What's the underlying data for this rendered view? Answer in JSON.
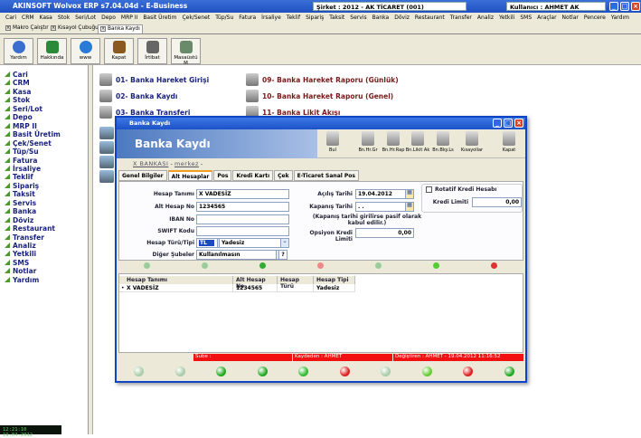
{
  "app": {
    "title": "AKINSOFT Wolvox ERP s7.04.04d - E-Business",
    "company": "Şirket : 2012 - AK TİCARET (001)",
    "user": "Kullanıcı : AHMET AK"
  },
  "menu": [
    "Cari",
    "CRM",
    "Kasa",
    "Stok",
    "Seri/Lot",
    "Depo",
    "MRP II",
    "Basit Üretim",
    "Çek/Senet",
    "Tüp/Su",
    "Fatura",
    "İrsaliye",
    "Teklif",
    "Sipariş",
    "Taksit",
    "Servis",
    "Banka",
    "Döviz",
    "Restaurant",
    "Transfer",
    "Analiz",
    "Yetkili",
    "SMS",
    "Araçlar",
    "Notlar",
    "Pencere",
    "Yardım"
  ],
  "doc_tabs": [
    "Makro Çalıştır",
    "Kısayol Çubuğu",
    "Banka Kaydı"
  ],
  "toolbar": [
    "Yardım",
    "Hakkında",
    "www",
    "Kapat",
    "İrtibat",
    "Masaüstü M"
  ],
  "sidebar": [
    "Cari",
    "CRM",
    "Kasa",
    "Stok",
    "Seri/Lot",
    "Depo",
    "MRP II",
    "Basit Üretim",
    "Çek/Senet",
    "Tüp/Su",
    "Fatura",
    "İrsaliye",
    "Teklif",
    "Sipariş",
    "Taksit",
    "Servis",
    "Banka",
    "Döviz",
    "Restaurant",
    "Transfer",
    "Analiz",
    "Yetkili",
    "SMS",
    "Notlar",
    "Yardım"
  ],
  "links_left": [
    "01- Banka Hareket Girişi",
    "02- Banka Kaydı",
    "03- Banka Transferi"
  ],
  "links_right": [
    "09- Banka Hareket Raporu (Günlük)",
    "10- Banka Hareket Raporu (Genel)",
    "11- Banka Likit Akışı"
  ],
  "clock": "12:21:10 19.04.2012",
  "dialog": {
    "title": "Banka Kaydı",
    "header": "Banka Kaydı",
    "buttons": [
      "Bul",
      "Bn.Hr.Gr",
      "Bn.Hr.Rap",
      "Bn.Likit Ak",
      "Bn.Bky.Ls",
      "Kısayollar",
      "Kapat"
    ],
    "bank": "X BANKASI",
    "sep1": "-",
    "branch": "merkez",
    "sep2": "-",
    "tabs": [
      "Genel Bilgiler",
      "Alt Hesaplar",
      "Pos",
      "Kredi Kartı",
      "Çek",
      "E-Ticaret Sanal Pos"
    ],
    "form": {
      "hesap_tanimi_label": "Hesap Tanımı",
      "hesap_tanimi": "X VADESİZ",
      "alt_hesap_no_label": "Alt Hesap No",
      "alt_hesap_no": "1234565",
      "iban_label": "IBAN No",
      "iban": "",
      "swift_label": "SWIFT Kodu",
      "swift": "",
      "hesap_turu_label": "Hesap Türü/Tipi",
      "hesap_turu": "TL",
      "hesap_tipi": "Yadesiz",
      "diger_subeler_label": "Diğer Şubeler",
      "diger_subeler": "Kullanılmasın",
      "help": "?",
      "acilis_label": "Açılış Tarihi",
      "acilis": "19.04.2012",
      "kapanis_label": "Kapanış Tarihi",
      "kapanis": ". .",
      "note": "(Kapanış tarihi girilirse pasif olarak kabul edilir.)",
      "opsiyon_label": "Opsiyon Kredi Limiti",
      "opsiyon": "0,00",
      "rotatif_label": "Rotatif Kredi Hesabı",
      "kredi_limiti_label": "Kredi Limiti",
      "kredi_limiti": "0,00"
    },
    "grid": {
      "headers": [
        "Hesap Tanımı",
        "Alt Hesap No",
        "Hesap Türü",
        "Hesap Tipi"
      ],
      "rows": [
        [
          "X VADESİZ",
          "1234565",
          "",
          "Yadesiz"
        ]
      ]
    },
    "status": {
      "sube": "Sube :",
      "kaydeden": "Kaydeden : AHMET",
      "degistiren": "Değiştiren : AHMET - 19.04.2012 11:16:52"
    }
  }
}
